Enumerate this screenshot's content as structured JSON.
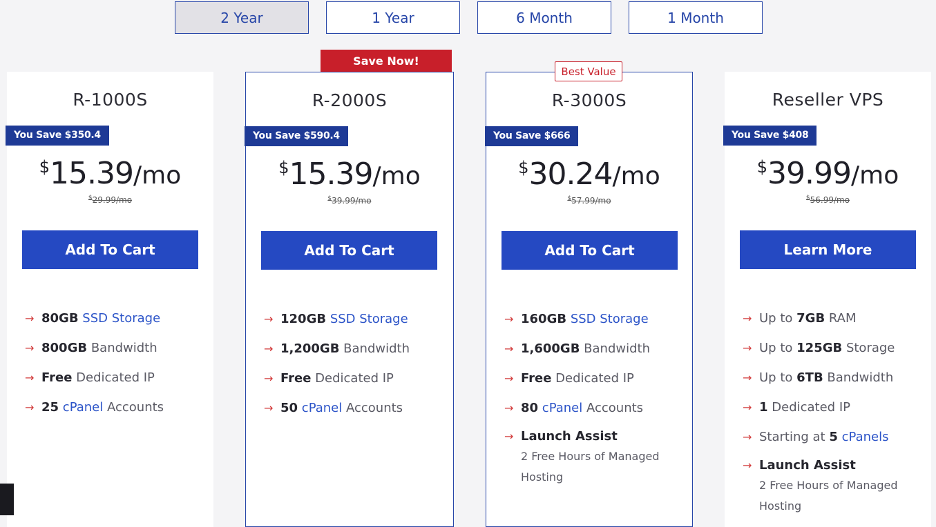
{
  "tabs": [
    {
      "label": "2 Year",
      "active": true
    },
    {
      "label": "1 Year",
      "active": false
    },
    {
      "label": "6 Month",
      "active": false
    },
    {
      "label": "1 Month",
      "active": false
    }
  ],
  "ribbons": {
    "save_now": "Save Now!",
    "best_value": "Best Value"
  },
  "plans": [
    {
      "name": "R-1000S",
      "savings": "You Save $350.4",
      "currency": "$",
      "price": "15.39",
      "per": "/mo",
      "old_currency": "$",
      "old_price": "29.99/mo",
      "cta": "Add To Cart",
      "features": [
        {
          "bold": "80GB",
          "link": "SSD Storage",
          "rest": ""
        },
        {
          "bold": "800GB",
          "link": "",
          "rest": "Bandwidth"
        },
        {
          "bold": "Free",
          "link": "",
          "rest": "Dedicated IP"
        },
        {
          "bold": "25",
          "link": "cPanel",
          "rest": "Accounts"
        }
      ]
    },
    {
      "name": "R-2000S",
      "savings": "You Save $590.4",
      "currency": "$",
      "price": "15.39",
      "per": "/mo",
      "old_currency": "$",
      "old_price": "39.99/mo",
      "cta": "Add To Cart",
      "features": [
        {
          "bold": "120GB",
          "link": "SSD Storage",
          "rest": ""
        },
        {
          "bold": "1,200GB",
          "link": "",
          "rest": "Bandwidth"
        },
        {
          "bold": "Free",
          "link": "",
          "rest": "Dedicated IP"
        },
        {
          "bold": "50",
          "link": "cPanel",
          "rest": "Accounts"
        }
      ]
    },
    {
      "name": "R-3000S",
      "savings": "You Save $666",
      "currency": "$",
      "price": "30.24",
      "per": "/mo",
      "old_currency": "$",
      "old_price": "57.99/mo",
      "cta": "Add To Cart",
      "features": [
        {
          "bold": "160GB",
          "link": "SSD Storage",
          "rest": ""
        },
        {
          "bold": "1,600GB",
          "link": "",
          "rest": "Bandwidth"
        },
        {
          "bold": "Free",
          "link": "",
          "rest": "Dedicated IP"
        },
        {
          "bold": "80",
          "link": "cPanel",
          "rest": "Accounts"
        }
      ],
      "assist_title": "Launch Assist",
      "assist_sub": "2 Free Hours of Managed Hosting"
    },
    {
      "name": "Reseller VPS",
      "savings": "You Save $408",
      "currency": "$",
      "price": "39.99",
      "per": "/mo",
      "old_currency": "$",
      "old_price": "56.99/mo",
      "cta": "Learn More",
      "features": [
        {
          "pre": "Up to",
          "bold": "7GB",
          "rest": "RAM"
        },
        {
          "pre": "Up to",
          "bold": "125GB",
          "rest": "Storage"
        },
        {
          "pre": "Up to",
          "bold": "6TB",
          "rest": "Bandwidth"
        },
        {
          "pre": "",
          "bold": "1",
          "rest": "Dedicated IP"
        },
        {
          "pre": "Starting at",
          "bold": "5",
          "link": "cPanels"
        }
      ],
      "assist_title": "Launch Assist",
      "assist_sub": "2 Free Hours of Managed Hosting"
    }
  ],
  "colors": {
    "accent": "#2549c2",
    "badge": "#1e3a96",
    "ribbon": "#c81f2a",
    "arrow": "#d23a3a"
  }
}
